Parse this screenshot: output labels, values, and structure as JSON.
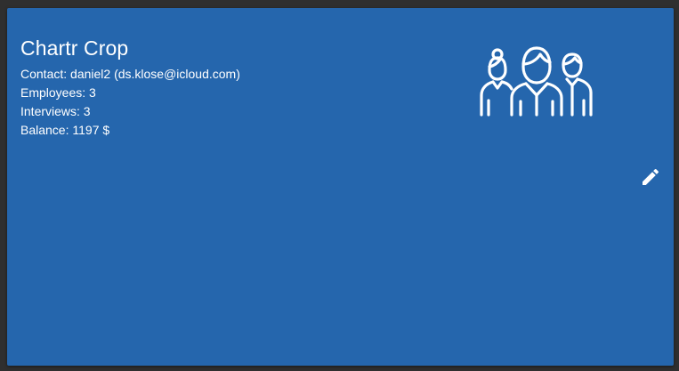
{
  "company": {
    "name": "Chartr Crop",
    "contact_label": "Contact: daniel2 (ds.klose@icloud.com)",
    "employees_label": "Employees: 3",
    "interviews_label": "Interviews: 3",
    "balance_label": "Balance: 1197 $"
  },
  "icons": {
    "team": "team-people-icon",
    "edit": "pencil-edit-icon"
  },
  "colors": {
    "card_background": "#2566ad",
    "page_background": "#2f2f2f",
    "text": "#ffffff"
  }
}
